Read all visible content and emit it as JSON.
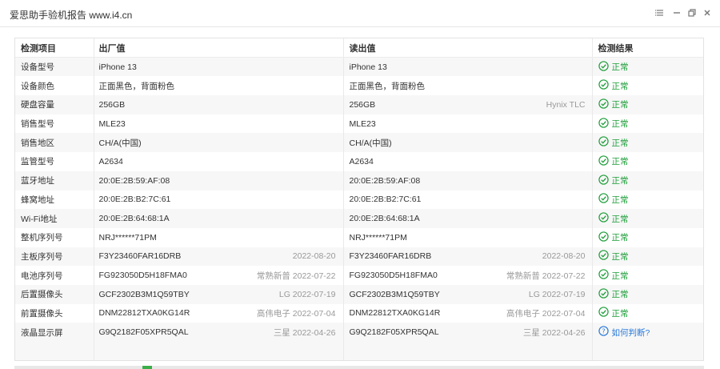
{
  "window": {
    "title": "爱思助手验机报告 www.i4.cn",
    "controls": [
      "list-icon",
      "minimize-icon",
      "restore-icon",
      "close-icon"
    ]
  },
  "table": {
    "headers": [
      "检测项目",
      "出厂值",
      "读出值",
      "检测结果"
    ],
    "rows": [
      {
        "item": "设备型号",
        "factory": "iPhone 13",
        "factory_meta": "",
        "read": "iPhone 13",
        "read_meta": "",
        "result": "正常",
        "status": "ok"
      },
      {
        "item": "设备颜色",
        "factory": "正面黑色，背面粉色",
        "factory_meta": "",
        "read": "正面黑色，背面粉色",
        "read_meta": "",
        "result": "正常",
        "status": "ok"
      },
      {
        "item": "硬盘容量",
        "factory": "256GB",
        "factory_meta": "",
        "read": "256GB",
        "read_meta": "Hynix TLC",
        "result": "正常",
        "status": "ok"
      },
      {
        "item": "销售型号",
        "factory": "MLE23",
        "factory_meta": "",
        "read": "MLE23",
        "read_meta": "",
        "result": "正常",
        "status": "ok"
      },
      {
        "item": "销售地区",
        "factory": "CH/A(中国)",
        "factory_meta": "",
        "read": "CH/A(中国)",
        "read_meta": "",
        "result": "正常",
        "status": "ok"
      },
      {
        "item": "监管型号",
        "factory": "A2634",
        "factory_meta": "",
        "read": "A2634",
        "read_meta": "",
        "result": "正常",
        "status": "ok"
      },
      {
        "item": "蓝牙地址",
        "factory": "20:0E:2B:59:AF:08",
        "factory_meta": "",
        "read": "20:0E:2B:59:AF:08",
        "read_meta": "",
        "result": "正常",
        "status": "ok"
      },
      {
        "item": "蜂窝地址",
        "factory": "20:0E:2B:B2:7C:61",
        "factory_meta": "",
        "read": "20:0E:2B:B2:7C:61",
        "read_meta": "",
        "result": "正常",
        "status": "ok"
      },
      {
        "item": "Wi-Fi地址",
        "factory": "20:0E:2B:64:68:1A",
        "factory_meta": "",
        "read": "20:0E:2B:64:68:1A",
        "read_meta": "",
        "result": "正常",
        "status": "ok"
      },
      {
        "item": "整机序列号",
        "factory": "NRJ******71PM",
        "factory_meta": "",
        "read": "NRJ******71PM",
        "read_meta": "",
        "result": "正常",
        "status": "ok"
      },
      {
        "item": "主板序列号",
        "factory": "F3Y23460FAR16DRB",
        "factory_meta": "2022-08-20",
        "read": "F3Y23460FAR16DRB",
        "read_meta": "2022-08-20",
        "result": "正常",
        "status": "ok"
      },
      {
        "item": "电池序列号",
        "factory": "FG923050D5H18FMA0",
        "factory_meta": "常熟新普 2022-07-22",
        "read": "FG923050D5H18FMA0",
        "read_meta": "常熟新普 2022-07-22",
        "result": "正常",
        "status": "ok"
      },
      {
        "item": "后置摄像头",
        "factory": "GCF2302B3M1Q59TBY",
        "factory_meta": "LG 2022-07-19",
        "read": "GCF2302B3M1Q59TBY",
        "read_meta": "LG 2022-07-19",
        "result": "正常",
        "status": "ok"
      },
      {
        "item": "前置摄像头",
        "factory": "DNM22812TXA0KG14R",
        "factory_meta": "高伟电子 2022-07-04",
        "read": "DNM22812TXA0KG14R",
        "read_meta": "高伟电子 2022-07-04",
        "result": "正常",
        "status": "ok"
      },
      {
        "item": "液晶显示屏",
        "factory": "G9Q2182F05XPR5QAL",
        "factory_meta": "三星 2022-04-26",
        "read": "G9Q2182F05XPR5QAL",
        "read_meta": "三星 2022-04-26",
        "result": "如何判断?",
        "status": "help"
      }
    ]
  },
  "colors": {
    "ok": "#1e9e3a",
    "help": "#2a7ad9"
  }
}
